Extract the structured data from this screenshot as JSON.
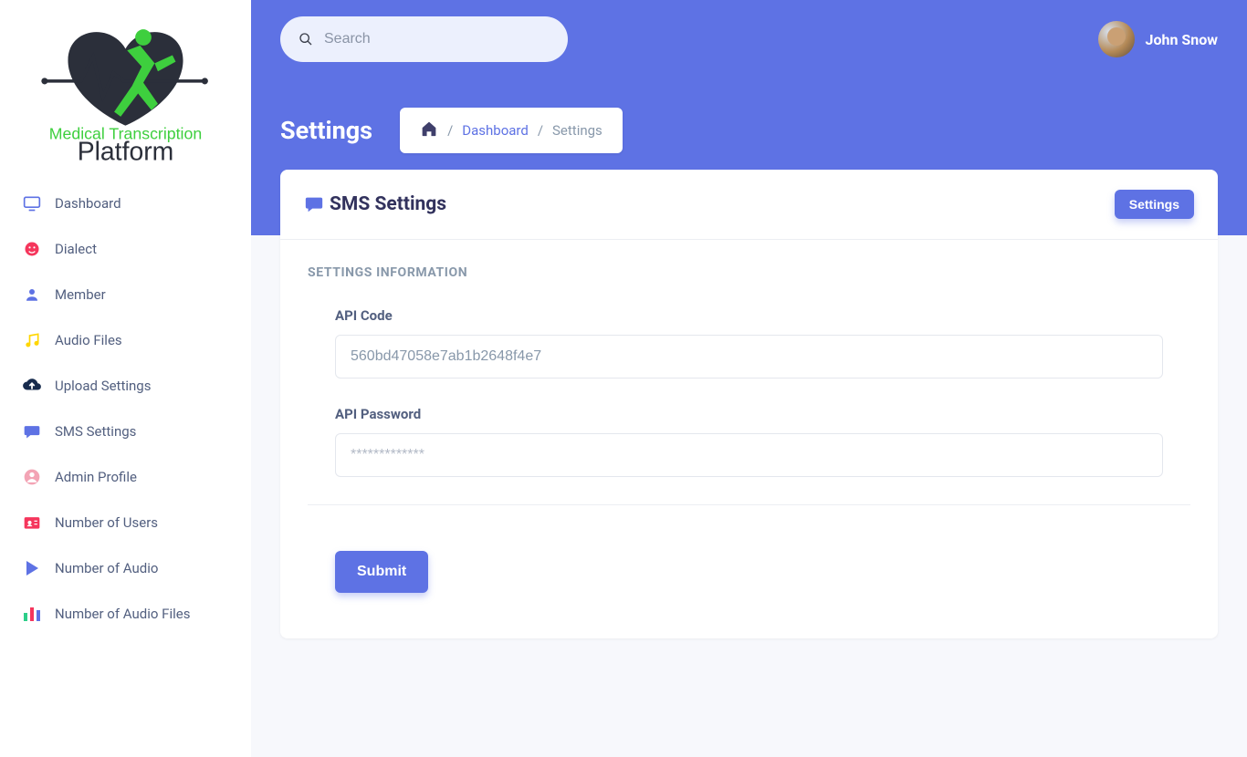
{
  "brand": {
    "line1": "Medical Transcription",
    "line2": "Platform"
  },
  "sidebar": {
    "items": [
      {
        "icon": "monitor-icon",
        "label": "Dashboard"
      },
      {
        "icon": "emoji-icon",
        "label": "Dialect"
      },
      {
        "icon": "person-icon",
        "label": "Member"
      },
      {
        "icon": "music-icon",
        "label": "Audio Files"
      },
      {
        "icon": "cloud-up-icon",
        "label": "Upload Settings"
      },
      {
        "icon": "chat-icon",
        "label": "SMS Settings"
      },
      {
        "icon": "avatar-icon",
        "label": "Admin Profile"
      },
      {
        "icon": "id-icon",
        "label": "Number of Users"
      },
      {
        "icon": "play-icon",
        "label": "Number of Audio"
      },
      {
        "icon": "bars-icon",
        "label": "Number of Audio Files"
      }
    ]
  },
  "header": {
    "search_placeholder": "Search",
    "user_name": "John Snow"
  },
  "page": {
    "title": "Settings",
    "breadcrumb": {
      "dashboard": "Dashboard",
      "current": "Settings"
    }
  },
  "card": {
    "title": "SMS Settings",
    "settings_button": "Settings",
    "section_label": "Settings information",
    "fields": {
      "api_code_label": "API Code",
      "api_code_value": "560bd47058e7ab1b2648f4e7",
      "api_password_label": "API Password",
      "api_password_placeholder": "*************"
    },
    "submit": "Submit"
  },
  "icon_colors": {
    "monitor": "#5e72e4",
    "emoji": "#f5365c",
    "person": "#5e72e4",
    "music": "#ffd600",
    "cloud": "#172b4d",
    "chat": "#5e72e4",
    "avatar": "#f3a4b5",
    "id": "#f5365c",
    "play": "#5e72e4",
    "bars": "#2dce89"
  }
}
